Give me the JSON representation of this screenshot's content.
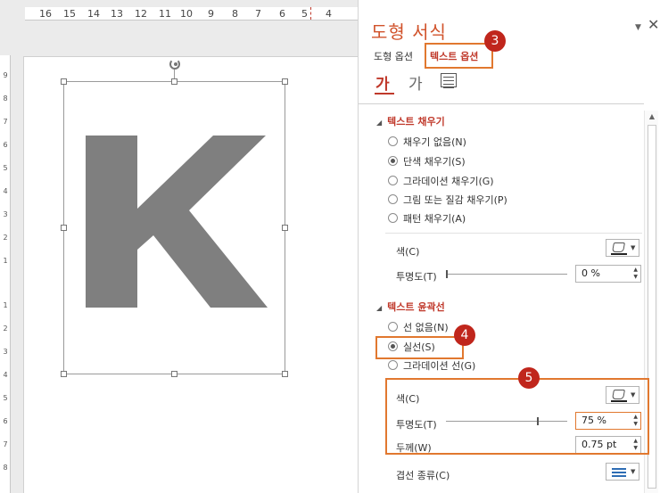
{
  "ruler": {
    "top_labels": [
      "16",
      "15",
      "14",
      "13",
      "12",
      "11",
      "10",
      "9",
      "8",
      "7",
      "6",
      "5",
      "4"
    ],
    "left_labels": [
      "9",
      "8",
      "7",
      "6",
      "5",
      "4",
      "3",
      "2",
      "1",
      "1",
      "2",
      "3",
      "4",
      "5",
      "6",
      "7",
      "8"
    ]
  },
  "slide": {
    "shape_letter": "K",
    "letter_color": "#7f7f7f"
  },
  "pane": {
    "title": "도형 서식",
    "tabs": {
      "shape_options": "도형 옵션",
      "text_options": "텍스트 옵션"
    },
    "icon_tabs": {
      "fill": "가",
      "effects": "가"
    },
    "text_fill": {
      "heading": "텍스트 채우기",
      "options": [
        {
          "label": "채우기 없음(N)",
          "selected": false
        },
        {
          "label": "단색 채우기(S)",
          "selected": true
        },
        {
          "label": "그라데이션 채우기(G)",
          "selected": false
        },
        {
          "label": "그림 또는 질감 채우기(P)",
          "selected": false
        },
        {
          "label": "패턴 채우기(A)",
          "selected": false
        }
      ],
      "color_label": "색(C)",
      "transparency_label": "투명도(T)",
      "transparency_value": "0 %",
      "transparency_level": 0
    },
    "text_outline": {
      "heading": "텍스트 윤곽선",
      "options": [
        {
          "label": "선 없음(N)",
          "selected": false
        },
        {
          "label": "실선(S)",
          "selected": true
        },
        {
          "label": "그라데이션 선(G)",
          "selected": false
        }
      ],
      "color_label": "색(C)",
      "transparency_label": "투명도(T)",
      "transparency_value": "75 %",
      "transparency_level": 0.75,
      "width_label": "두께(W)",
      "width_value": "0.75 pt",
      "compound_label": "겹선 종류(C)"
    }
  },
  "annotations": {
    "callout_3": "3",
    "callout_4": "4",
    "callout_5": "5",
    "accent_color": "#e1782f",
    "callout_color": "#c0261c"
  }
}
